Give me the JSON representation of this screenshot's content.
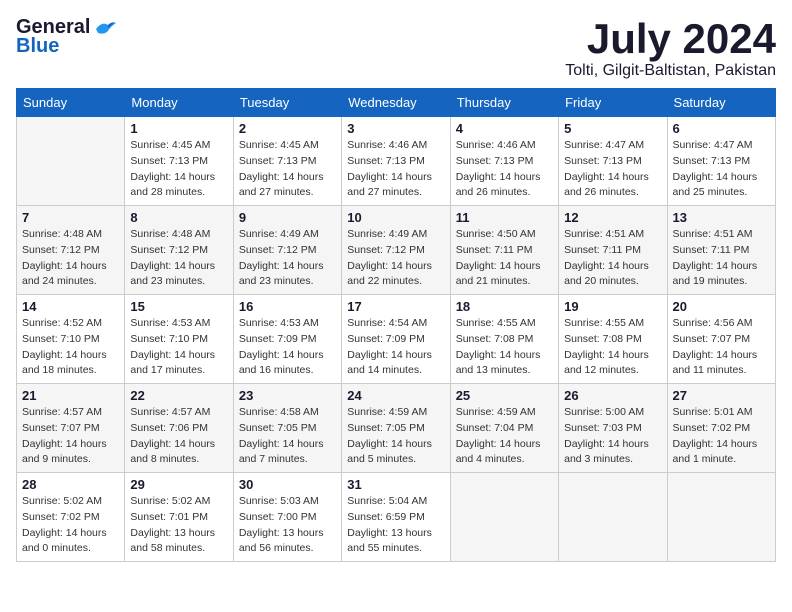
{
  "header": {
    "logo_general": "General",
    "logo_blue": "Blue",
    "month": "July 2024",
    "location": "Tolti, Gilgit-Baltistan, Pakistan"
  },
  "weekdays": [
    "Sunday",
    "Monday",
    "Tuesday",
    "Wednesday",
    "Thursday",
    "Friday",
    "Saturday"
  ],
  "weeks": [
    [
      {
        "day": "",
        "sunrise": "",
        "sunset": "",
        "daylight": ""
      },
      {
        "day": "1",
        "sunrise": "Sunrise: 4:45 AM",
        "sunset": "Sunset: 7:13 PM",
        "daylight": "Daylight: 14 hours and 28 minutes."
      },
      {
        "day": "2",
        "sunrise": "Sunrise: 4:45 AM",
        "sunset": "Sunset: 7:13 PM",
        "daylight": "Daylight: 14 hours and 27 minutes."
      },
      {
        "day": "3",
        "sunrise": "Sunrise: 4:46 AM",
        "sunset": "Sunset: 7:13 PM",
        "daylight": "Daylight: 14 hours and 27 minutes."
      },
      {
        "day": "4",
        "sunrise": "Sunrise: 4:46 AM",
        "sunset": "Sunset: 7:13 PM",
        "daylight": "Daylight: 14 hours and 26 minutes."
      },
      {
        "day": "5",
        "sunrise": "Sunrise: 4:47 AM",
        "sunset": "Sunset: 7:13 PM",
        "daylight": "Daylight: 14 hours and 26 minutes."
      },
      {
        "day": "6",
        "sunrise": "Sunrise: 4:47 AM",
        "sunset": "Sunset: 7:13 PM",
        "daylight": "Daylight: 14 hours and 25 minutes."
      }
    ],
    [
      {
        "day": "7",
        "sunrise": "Sunrise: 4:48 AM",
        "sunset": "Sunset: 7:12 PM",
        "daylight": "Daylight: 14 hours and 24 minutes."
      },
      {
        "day": "8",
        "sunrise": "Sunrise: 4:48 AM",
        "sunset": "Sunset: 7:12 PM",
        "daylight": "Daylight: 14 hours and 23 minutes."
      },
      {
        "day": "9",
        "sunrise": "Sunrise: 4:49 AM",
        "sunset": "Sunset: 7:12 PM",
        "daylight": "Daylight: 14 hours and 23 minutes."
      },
      {
        "day": "10",
        "sunrise": "Sunrise: 4:49 AM",
        "sunset": "Sunset: 7:12 PM",
        "daylight": "Daylight: 14 hours and 22 minutes."
      },
      {
        "day": "11",
        "sunrise": "Sunrise: 4:50 AM",
        "sunset": "Sunset: 7:11 PM",
        "daylight": "Daylight: 14 hours and 21 minutes."
      },
      {
        "day": "12",
        "sunrise": "Sunrise: 4:51 AM",
        "sunset": "Sunset: 7:11 PM",
        "daylight": "Daylight: 14 hours and 20 minutes."
      },
      {
        "day": "13",
        "sunrise": "Sunrise: 4:51 AM",
        "sunset": "Sunset: 7:11 PM",
        "daylight": "Daylight: 14 hours and 19 minutes."
      }
    ],
    [
      {
        "day": "14",
        "sunrise": "Sunrise: 4:52 AM",
        "sunset": "Sunset: 7:10 PM",
        "daylight": "Daylight: 14 hours and 18 minutes."
      },
      {
        "day": "15",
        "sunrise": "Sunrise: 4:53 AM",
        "sunset": "Sunset: 7:10 PM",
        "daylight": "Daylight: 14 hours and 17 minutes."
      },
      {
        "day": "16",
        "sunrise": "Sunrise: 4:53 AM",
        "sunset": "Sunset: 7:09 PM",
        "daylight": "Daylight: 14 hours and 16 minutes."
      },
      {
        "day": "17",
        "sunrise": "Sunrise: 4:54 AM",
        "sunset": "Sunset: 7:09 PM",
        "daylight": "Daylight: 14 hours and 14 minutes."
      },
      {
        "day": "18",
        "sunrise": "Sunrise: 4:55 AM",
        "sunset": "Sunset: 7:08 PM",
        "daylight": "Daylight: 14 hours and 13 minutes."
      },
      {
        "day": "19",
        "sunrise": "Sunrise: 4:55 AM",
        "sunset": "Sunset: 7:08 PM",
        "daylight": "Daylight: 14 hours and 12 minutes."
      },
      {
        "day": "20",
        "sunrise": "Sunrise: 4:56 AM",
        "sunset": "Sunset: 7:07 PM",
        "daylight": "Daylight: 14 hours and 11 minutes."
      }
    ],
    [
      {
        "day": "21",
        "sunrise": "Sunrise: 4:57 AM",
        "sunset": "Sunset: 7:07 PM",
        "daylight": "Daylight: 14 hours and 9 minutes."
      },
      {
        "day": "22",
        "sunrise": "Sunrise: 4:57 AM",
        "sunset": "Sunset: 7:06 PM",
        "daylight": "Daylight: 14 hours and 8 minutes."
      },
      {
        "day": "23",
        "sunrise": "Sunrise: 4:58 AM",
        "sunset": "Sunset: 7:05 PM",
        "daylight": "Daylight: 14 hours and 7 minutes."
      },
      {
        "day": "24",
        "sunrise": "Sunrise: 4:59 AM",
        "sunset": "Sunset: 7:05 PM",
        "daylight": "Daylight: 14 hours and 5 minutes."
      },
      {
        "day": "25",
        "sunrise": "Sunrise: 4:59 AM",
        "sunset": "Sunset: 7:04 PM",
        "daylight": "Daylight: 14 hours and 4 minutes."
      },
      {
        "day": "26",
        "sunrise": "Sunrise: 5:00 AM",
        "sunset": "Sunset: 7:03 PM",
        "daylight": "Daylight: 14 hours and 3 minutes."
      },
      {
        "day": "27",
        "sunrise": "Sunrise: 5:01 AM",
        "sunset": "Sunset: 7:02 PM",
        "daylight": "Daylight: 14 hours and 1 minute."
      }
    ],
    [
      {
        "day": "28",
        "sunrise": "Sunrise: 5:02 AM",
        "sunset": "Sunset: 7:02 PM",
        "daylight": "Daylight: 14 hours and 0 minutes."
      },
      {
        "day": "29",
        "sunrise": "Sunrise: 5:02 AM",
        "sunset": "Sunset: 7:01 PM",
        "daylight": "Daylight: 13 hours and 58 minutes."
      },
      {
        "day": "30",
        "sunrise": "Sunrise: 5:03 AM",
        "sunset": "Sunset: 7:00 PM",
        "daylight": "Daylight: 13 hours and 56 minutes."
      },
      {
        "day": "31",
        "sunrise": "Sunrise: 5:04 AM",
        "sunset": "Sunset: 6:59 PM",
        "daylight": "Daylight: 13 hours and 55 minutes."
      },
      {
        "day": "",
        "sunrise": "",
        "sunset": "",
        "daylight": ""
      },
      {
        "day": "",
        "sunrise": "",
        "sunset": "",
        "daylight": ""
      },
      {
        "day": "",
        "sunrise": "",
        "sunset": "",
        "daylight": ""
      }
    ]
  ]
}
